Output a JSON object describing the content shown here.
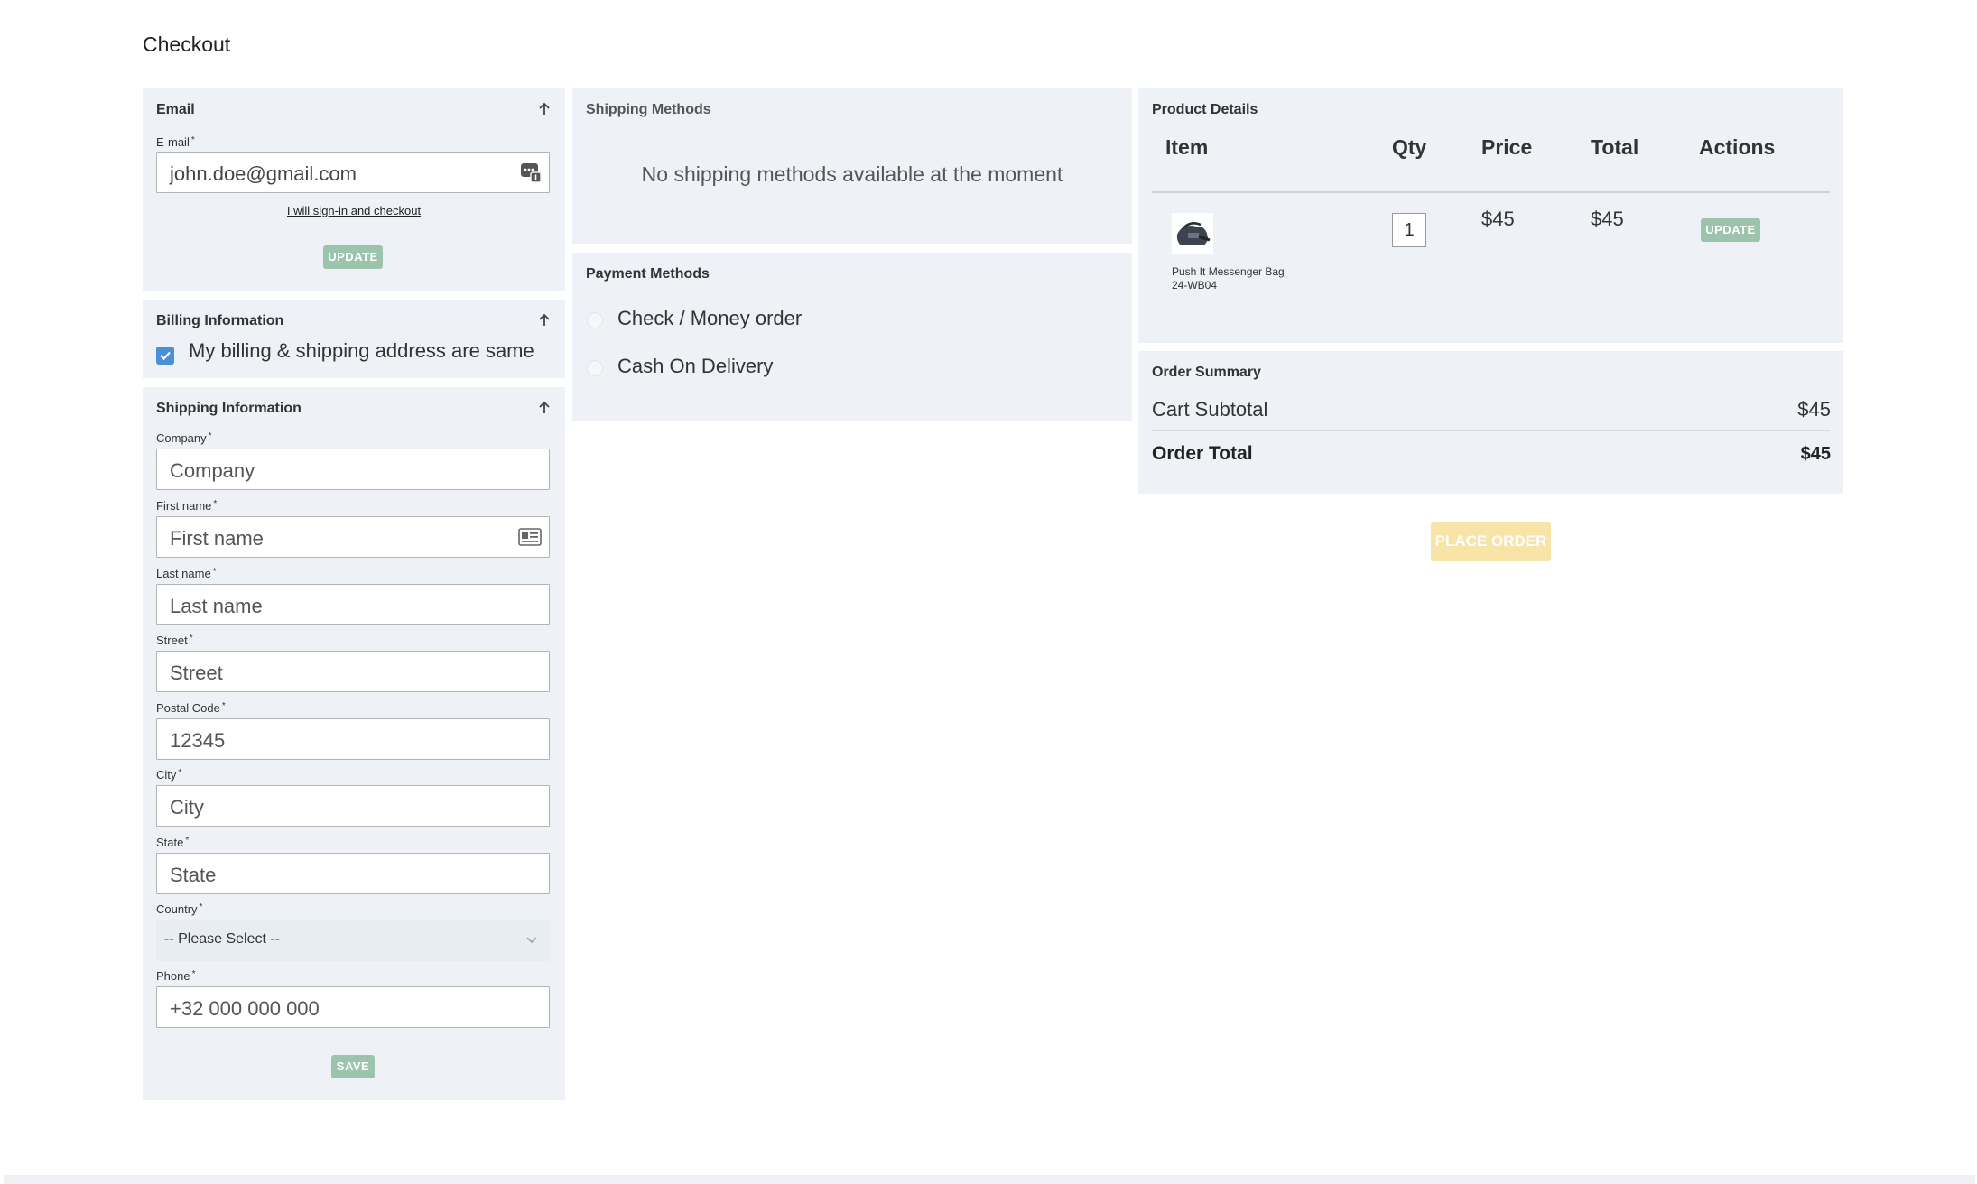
{
  "page": {
    "title": "Checkout"
  },
  "email": {
    "title": "Email",
    "label": "E-mail",
    "required_mark": "*",
    "value": "john.doe@gmail.com",
    "signin_link": "I will sign-in and checkout",
    "update_label": "UPDATE"
  },
  "billing": {
    "title": "Billing Information",
    "same_address_label": "My billing & shipping address are same",
    "same_address_checked": true
  },
  "shipping_info": {
    "title": "Shipping Information",
    "fields": {
      "company": {
        "label": "Company",
        "placeholder": "Company"
      },
      "first_name": {
        "label": "First name",
        "placeholder": "First name"
      },
      "last_name": {
        "label": "Last name",
        "placeholder": "Last name"
      },
      "street": {
        "label": "Street",
        "placeholder": "Street"
      },
      "postal_code": {
        "label": "Postal Code",
        "placeholder": "12345"
      },
      "city": {
        "label": "City",
        "placeholder": "City"
      },
      "state": {
        "label": "State",
        "placeholder": "State"
      },
      "country": {
        "label": "Country",
        "selected": "-- Please Select --"
      },
      "phone": {
        "label": "Phone",
        "placeholder": "+32 000 000 000"
      }
    },
    "save_label": "SAVE"
  },
  "shipping_methods": {
    "title": "Shipping Methods",
    "empty_message": "No shipping methods available at the moment"
  },
  "payment_methods": {
    "title": "Payment Methods",
    "options": [
      "Check / Money order",
      "Cash On Delivery"
    ]
  },
  "product_details": {
    "title": "Product Details",
    "columns": [
      "Item",
      "Qty",
      "Price",
      "Total",
      "Actions"
    ],
    "items": [
      {
        "name": "Push It Messenger Bag",
        "sku": "24-WB04",
        "qty": "1",
        "price": "$45",
        "total": "$45",
        "action_label": "UPDATE"
      }
    ]
  },
  "order_summary": {
    "title": "Order Summary",
    "subtotal_label": "Cart Subtotal",
    "subtotal_value": "$45",
    "total_label": "Order Total",
    "total_value": "$45"
  },
  "place_order_label": "PLACE ORDER",
  "colors": {
    "panel_bg": "#eef1f5",
    "button_green": "#9cc4ac",
    "place_order_yellow": "#f8e4a6",
    "checkbox_blue": "#4a90d9"
  },
  "icons": {
    "collapse": "arrow-up-icon",
    "email_field": "autofill-key-icon",
    "first_name_field": "contact-card-icon",
    "country_select": "chevron-down-icon"
  }
}
